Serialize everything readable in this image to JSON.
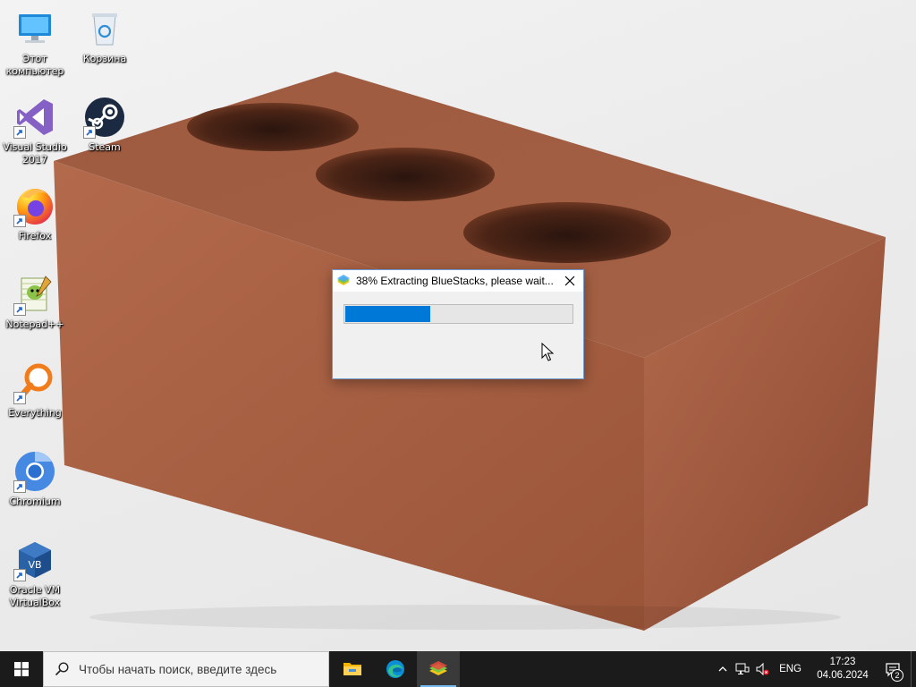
{
  "desktop": {
    "icons": [
      {
        "name": "this-pc",
        "label": "Этот компьютер",
        "shortcut": false
      },
      {
        "name": "recycle-bin",
        "label": "Корзина",
        "shortcut": false
      },
      {
        "name": "visual-studio",
        "label": "Visual Studio 2017",
        "shortcut": true
      },
      {
        "name": "steam",
        "label": "Steam",
        "shortcut": true
      },
      {
        "name": "firefox",
        "label": "Firefox",
        "shortcut": true
      },
      {
        "name": "notepadpp",
        "label": "Notepad++",
        "shortcut": true
      },
      {
        "name": "everything",
        "label": "Everything",
        "shortcut": true
      },
      {
        "name": "chromium",
        "label": "Chromium",
        "shortcut": true
      },
      {
        "name": "virtualbox",
        "label": "Oracle VM VirtualBox",
        "shortcut": true
      }
    ]
  },
  "dialog": {
    "title": "38% Extracting BlueStacks, please wait...",
    "progress_percent": 38,
    "progress_color": "#0078d7",
    "close_icon": "close-icon"
  },
  "taskbar": {
    "search_placeholder": "Чтобы начать поиск, введите здесь",
    "apps": [
      {
        "name": "file-explorer",
        "icon": "folder-icon"
      },
      {
        "name": "edge",
        "icon": "edge-icon"
      },
      {
        "name": "bluestacks",
        "icon": "bluestacks-icon",
        "active": true
      }
    ],
    "tray": {
      "language": "ENG",
      "time": "17:23",
      "date": "04.06.2024",
      "notifications": "2"
    }
  },
  "colors": {
    "taskbar": "#1b1b1b",
    "accent": "#0078d7",
    "brick": "#a35a3c"
  }
}
